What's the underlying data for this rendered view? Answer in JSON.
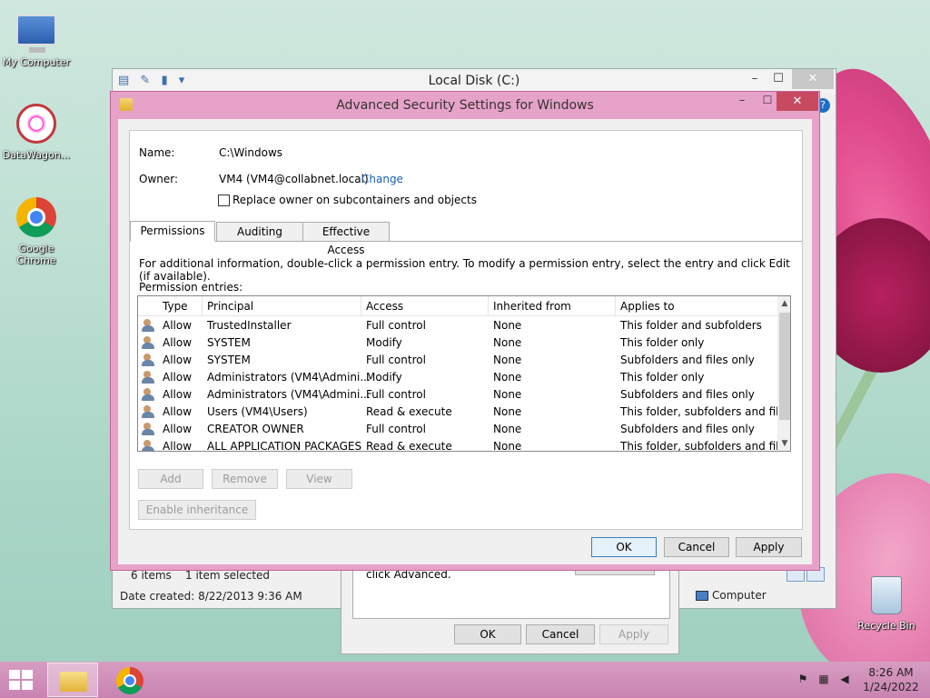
{
  "desktop": {
    "icons": [
      {
        "label": "My Computer"
      },
      {
        "label": "DataWagon..."
      },
      {
        "label": "Google Chrome"
      },
      {
        "label": "Recycle Bin"
      }
    ]
  },
  "explorer": {
    "title": "Local Disk (C:)",
    "items_count": "6 items",
    "selected": "1 item selected",
    "date_created": "Date created: 8/22/2013 9:36 AM",
    "location": "Computer",
    "help": "?"
  },
  "properties": {
    "hint": "click Advanced.",
    "ok": "OK",
    "cancel": "Cancel",
    "apply": "Apply"
  },
  "dialog": {
    "title": "Advanced Security Settings for Windows",
    "name_label": "Name:",
    "name_value": "C:\\Windows",
    "owner_label": "Owner:",
    "owner_value": "VM4 (VM4@collabnet.local)",
    "change_link": "Change",
    "replace_owner_label": "Replace owner on subcontainers and objects",
    "tabs": [
      {
        "label": "Permissions",
        "active": true
      },
      {
        "label": "Auditing",
        "active": false
      },
      {
        "label": "Effective Access",
        "active": false
      }
    ],
    "info_text": "For additional information, double-click a permission entry. To modify a permission entry, select the entry and click Edit (if available).",
    "entries_label": "Permission entries:",
    "columns": [
      "Type",
      "Principal",
      "Access",
      "Inherited from",
      "Applies to"
    ],
    "entries": [
      {
        "type": "Allow",
        "principal": "TrustedInstaller",
        "access": "Full control",
        "inherited": "None",
        "applies": "This folder and subfolders"
      },
      {
        "type": "Allow",
        "principal": "SYSTEM",
        "access": "Modify",
        "inherited": "None",
        "applies": "This folder only"
      },
      {
        "type": "Allow",
        "principal": "SYSTEM",
        "access": "Full control",
        "inherited": "None",
        "applies": "Subfolders and files only"
      },
      {
        "type": "Allow",
        "principal": "Administrators (VM4\\Admini...",
        "access": "Modify",
        "inherited": "None",
        "applies": "This folder only"
      },
      {
        "type": "Allow",
        "principal": "Administrators (VM4\\Admini...",
        "access": "Full control",
        "inherited": "None",
        "applies": "Subfolders and files only"
      },
      {
        "type": "Allow",
        "principal": "Users (VM4\\Users)",
        "access": "Read & execute",
        "inherited": "None",
        "applies": "This folder, subfolders and files"
      },
      {
        "type": "Allow",
        "principal": "CREATOR OWNER",
        "access": "Full control",
        "inherited": "None",
        "applies": "Subfolders and files only"
      },
      {
        "type": "Allow",
        "principal": "ALL APPLICATION PACKAGES",
        "access": "Read & execute",
        "inherited": "None",
        "applies": "This folder, subfolders and files"
      }
    ],
    "add": "Add",
    "remove": "Remove",
    "view": "View",
    "enable_inheritance": "Enable inheritance",
    "ok": "OK",
    "cancel": "Cancel",
    "apply": "Apply"
  },
  "taskbar": {
    "time": "8:26 AM",
    "date": "1/24/2022"
  }
}
